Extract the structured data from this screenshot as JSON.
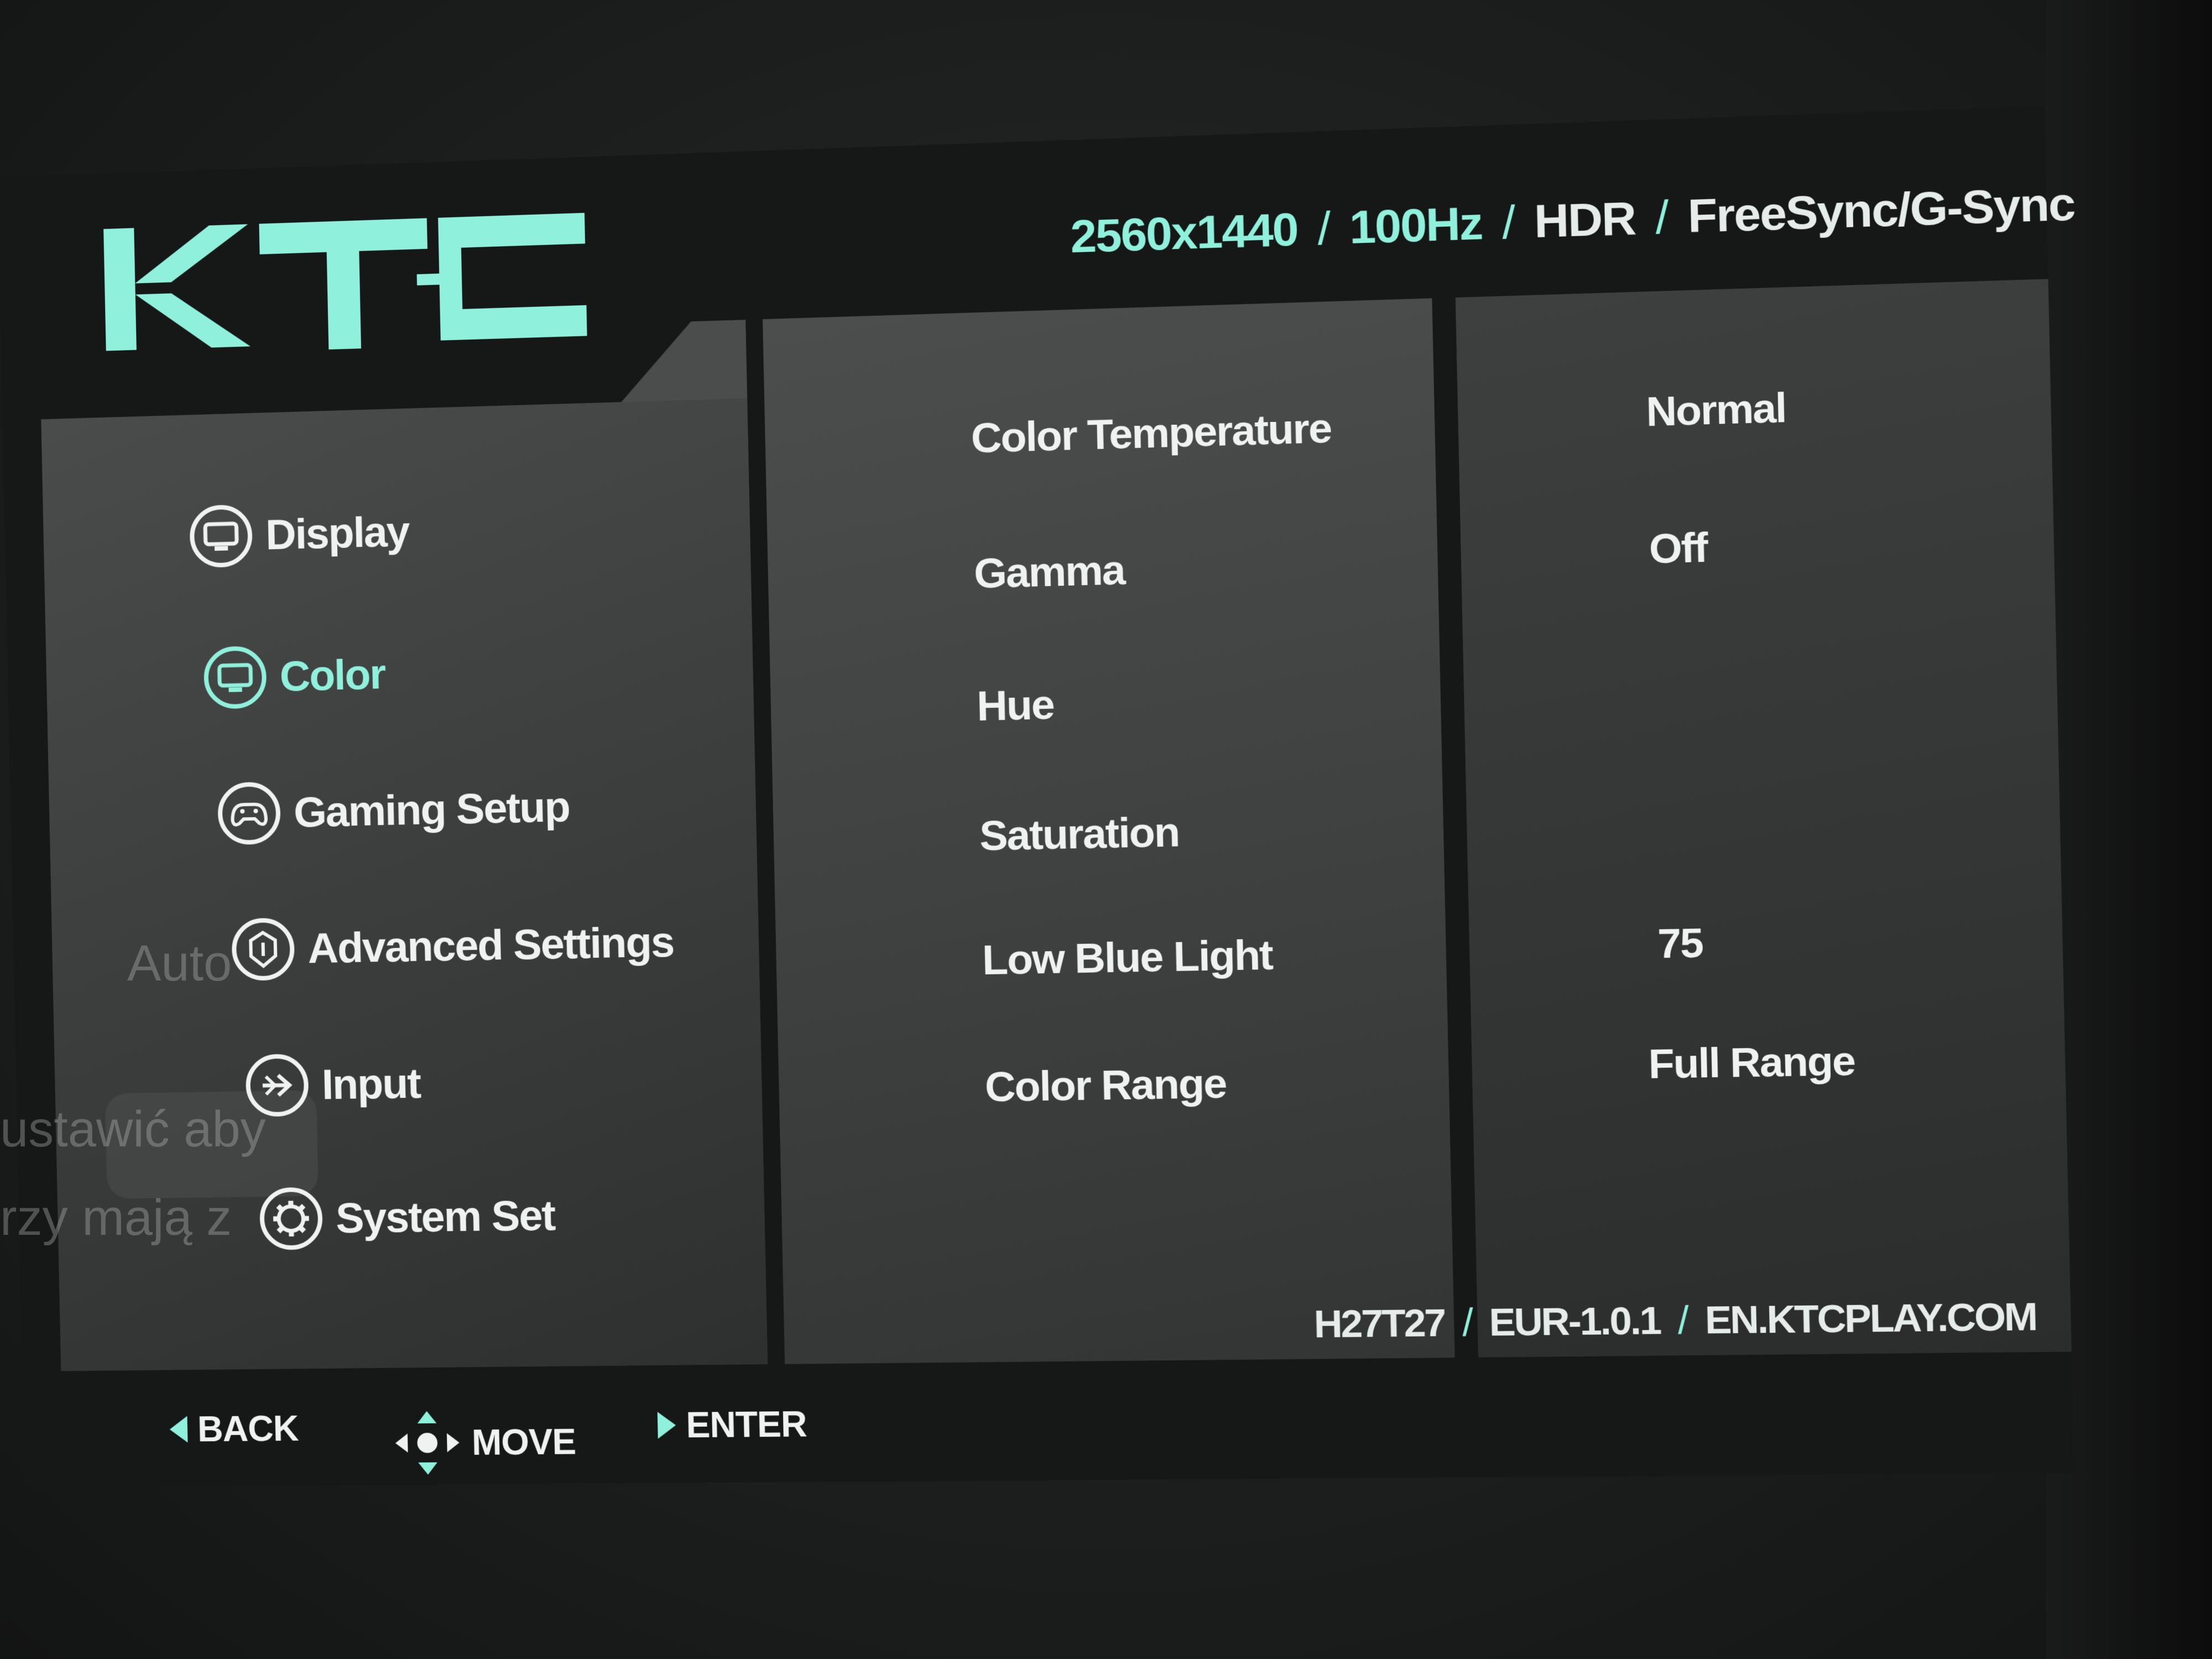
{
  "header": {
    "logo_text": "KTC",
    "specs": {
      "resolution": "2560x1440",
      "refresh": "100Hz",
      "hdr": "HDR",
      "sync": "FreeSync/G-Sync"
    }
  },
  "menu": {
    "items": [
      {
        "label": "Display",
        "icon": "monitor-icon"
      },
      {
        "label": "Color",
        "icon": "color-icon",
        "active": true
      },
      {
        "label": "Gaming Setup",
        "icon": "gamepad-icon"
      },
      {
        "label": "Advanced Settings",
        "icon": "advanced-settings-icon"
      },
      {
        "label": "Input",
        "icon": "input-icon"
      },
      {
        "label": "System Set",
        "icon": "gear-icon"
      }
    ]
  },
  "settings": [
    {
      "label": "Color Temperature",
      "value": "Normal"
    },
    {
      "label": "Gamma",
      "value": "Off"
    },
    {
      "label": "Hue",
      "value": ""
    },
    {
      "label": "Saturation",
      "value": ""
    },
    {
      "label": "Low Blue Light",
      "value": "75"
    },
    {
      "label": "Color Range",
      "value": "Full Range"
    }
  ],
  "footer": {
    "model": "H27T27",
    "firmware": "EUR-1.0.1",
    "website": "EN.KTCPLAY.COM",
    "nav": {
      "back": "BACK",
      "move": "MOVE",
      "enter": "ENTER"
    }
  },
  "reflection": {
    "pill_text": "Auto",
    "line1": "ustawić aby",
    "line2": "rzy mają z"
  },
  "colors": {
    "accent": "#8ff0dc",
    "text": "#eef2f1",
    "panel": "#444646",
    "background": "#161818"
  }
}
